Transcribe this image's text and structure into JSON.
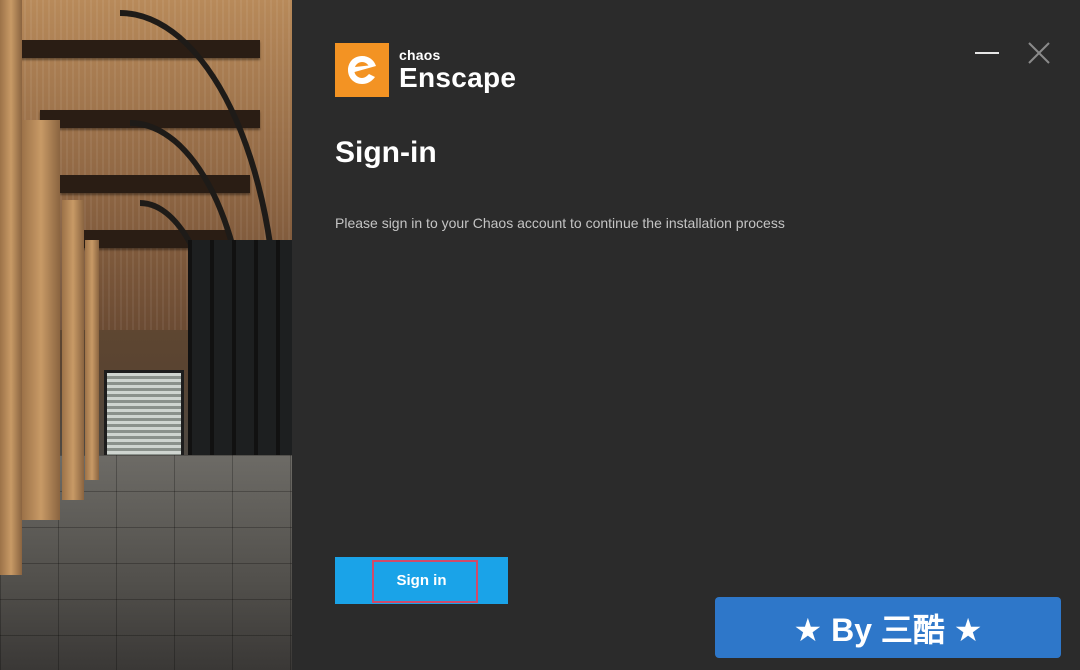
{
  "brand": {
    "company": "chaos",
    "product": "Enscape",
    "accent_color": "#f39323",
    "logo_icon": "enscape-e-icon"
  },
  "window_controls": {
    "minimize_icon": "minimize-icon",
    "close_icon": "close-icon"
  },
  "page": {
    "title": "Sign-in",
    "subtitle": "Please sign in to your Chaos account to continue the installation process"
  },
  "actions": {
    "signin_label": "Sign in",
    "signin_color": "#1aa3e8"
  },
  "watermark": {
    "text": "★ By 三酷 ★",
    "color": "#2e77c9"
  }
}
